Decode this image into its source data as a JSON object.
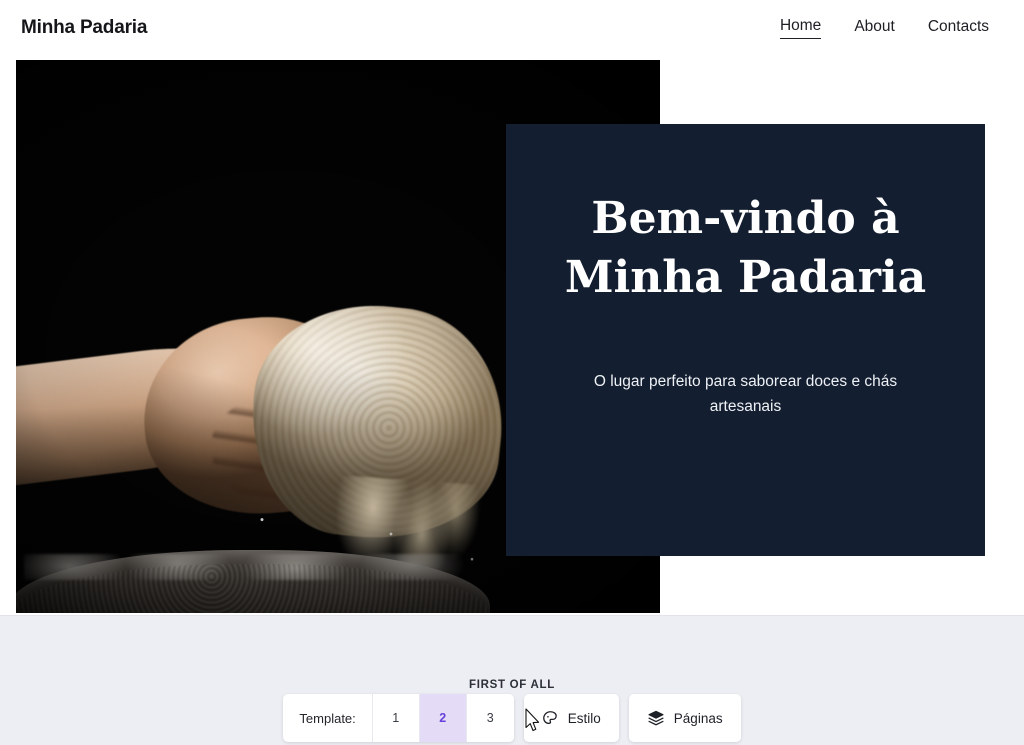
{
  "site": {
    "brand": "Minha Padaria",
    "nav": [
      {
        "label": "Home",
        "active": true
      },
      {
        "label": "About",
        "active": false
      },
      {
        "label": "Contacts",
        "active": false
      }
    ],
    "hero": {
      "image_alt": "hand squeezing bread dough over a dark stone bowl",
      "background_color": "#050505"
    },
    "welcome": {
      "title_line1": "Bem-vindo à",
      "title_line2": "Minha Padaria",
      "subtitle": "O lugar perfeito para saborear doces e chás artesanais",
      "panel_color": "#131e30",
      "title_color": "#ffffff"
    }
  },
  "editor": {
    "section_label": "FIRST OF ALL",
    "template": {
      "label": "Template:",
      "options": [
        "1",
        "2",
        "3"
      ],
      "selected": "2",
      "selected_bg": "#e4dcf7",
      "selected_fg": "#6741d9"
    },
    "buttons": [
      {
        "label": "Estilo",
        "icon": "palette-icon"
      },
      {
        "label": "Páginas",
        "icon": "layers-icon"
      }
    ],
    "bar_color": "#eceef3"
  }
}
